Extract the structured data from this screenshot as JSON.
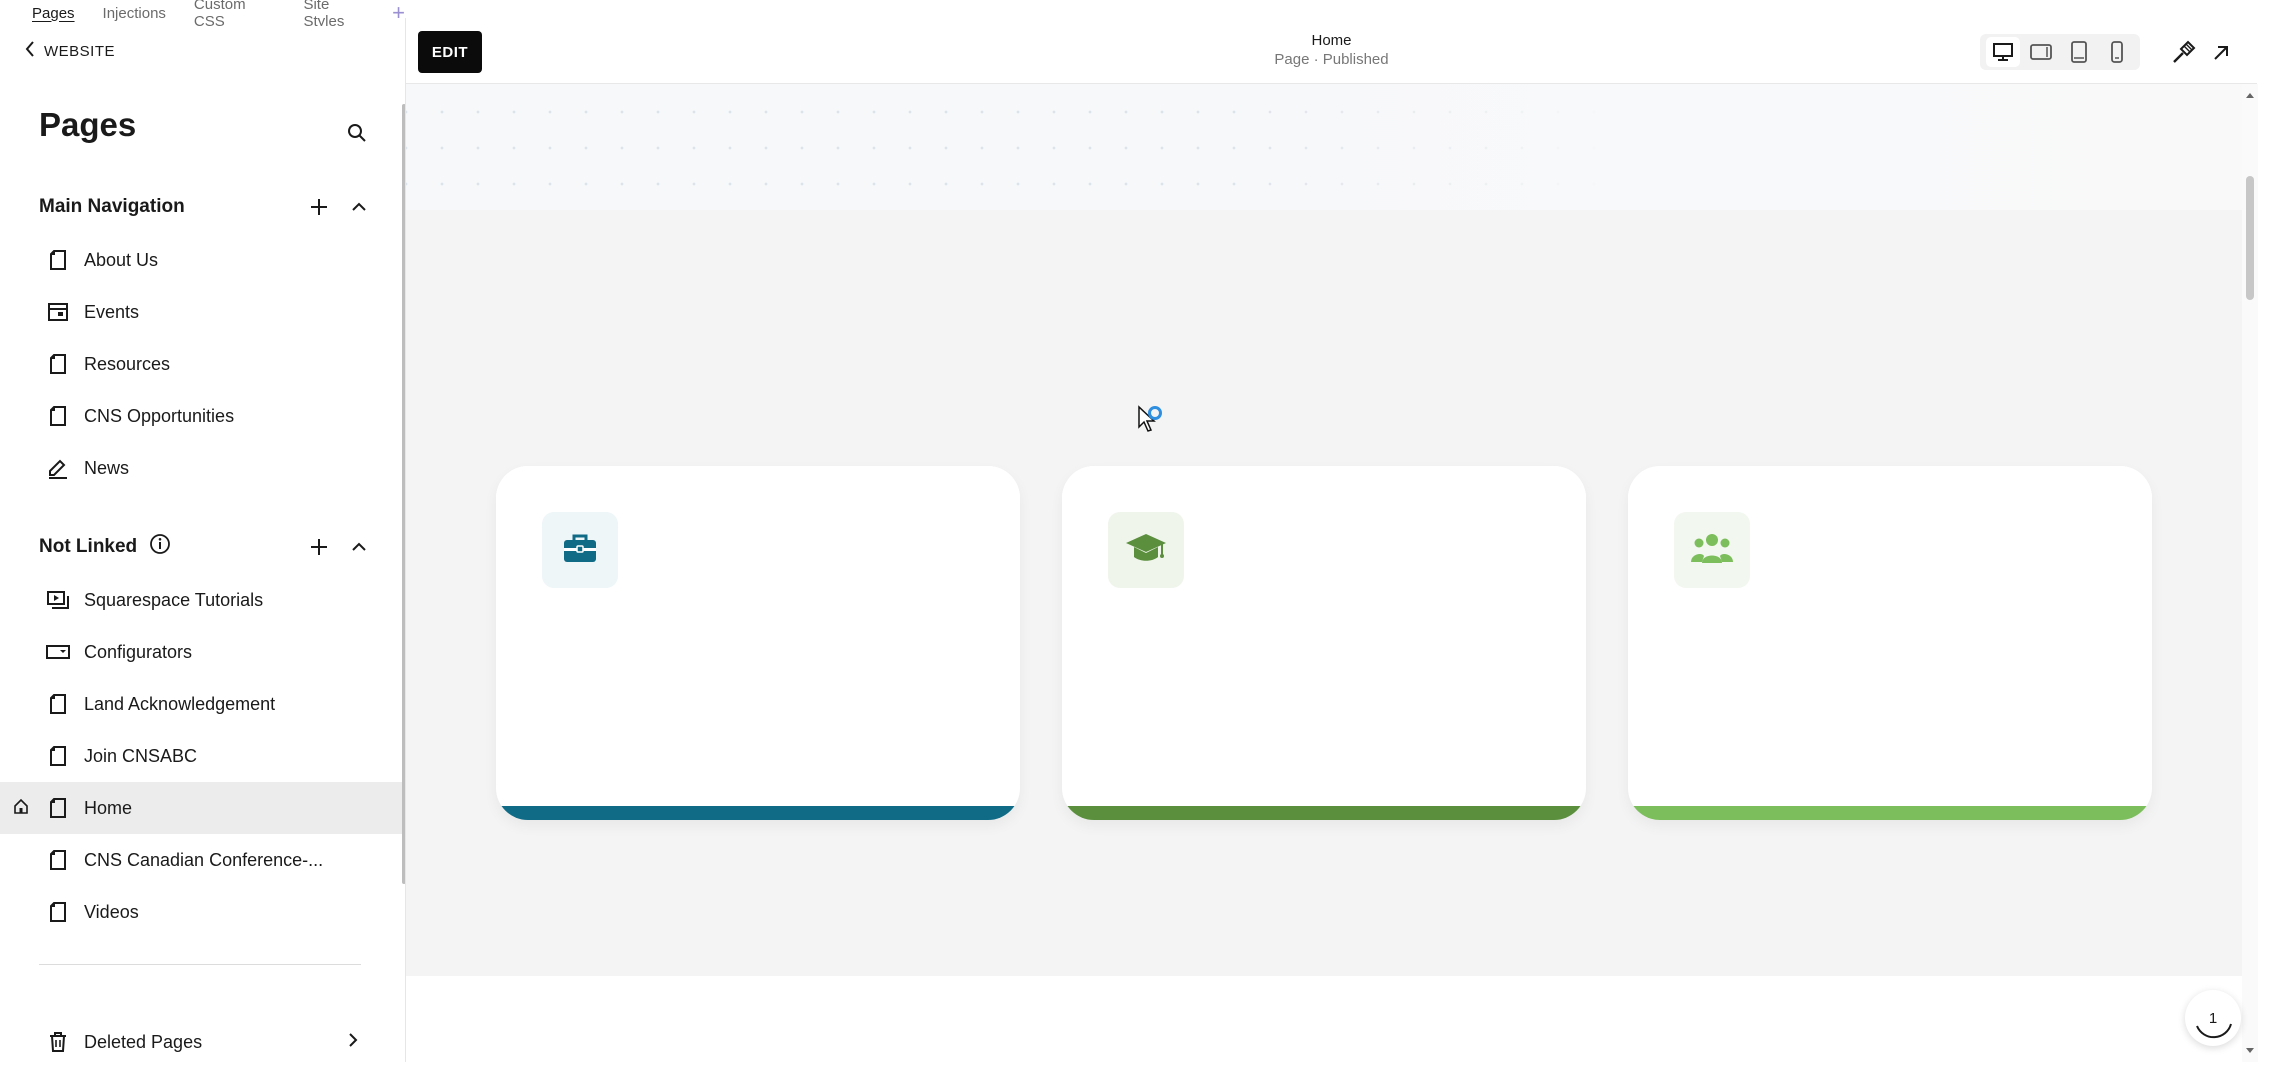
{
  "top_tabs": [
    "Pages",
    "Injections",
    "Custom CSS",
    "Site Styles"
  ],
  "back_label": "WEBSITE",
  "pages_title": "Pages",
  "main_nav": {
    "title": "Main Navigation",
    "items": [
      {
        "label": "About Us",
        "icon": "page-icon"
      },
      {
        "label": "Events",
        "icon": "calendar-page-icon"
      },
      {
        "label": "Resources",
        "icon": "page-icon"
      },
      {
        "label": "CNS Opportunities",
        "icon": "page-icon"
      },
      {
        "label": "News",
        "icon": "blog-icon"
      }
    ]
  },
  "not_linked": {
    "title": "Not Linked",
    "items": [
      {
        "label": "Squarespace Tutorials",
        "icon": "video-page-icon"
      },
      {
        "label": "Configurators",
        "icon": "dropdown-page-icon"
      },
      {
        "label": "Land Acknowledgement",
        "icon": "page-icon"
      },
      {
        "label": "Join CNSABC",
        "icon": "page-icon"
      },
      {
        "label": "Home",
        "icon": "page-icon",
        "is_homepage": true,
        "selected": true
      },
      {
        "label": "CNS Canadian Conference-...",
        "icon": "page-icon"
      },
      {
        "label": "Videos",
        "icon": "page-icon"
      }
    ]
  },
  "deleted_pages": "Deleted Pages",
  "preview": {
    "edit_label": "EDIT",
    "page_title": "Home",
    "page_status": "Page · Published",
    "devices": [
      "desktop",
      "tablet-landscape",
      "tablet-portrait",
      "mobile"
    ],
    "active_device": "desktop",
    "cards": [
      {
        "icon": "briefcase-icon",
        "accent": "#0f6b86",
        "icon_bg": "#eef6f8"
      },
      {
        "icon": "graduation-cap-icon",
        "accent": "#5b8f3e",
        "icon_bg": "#f0f5ec"
      },
      {
        "icon": "users-icon",
        "accent": "#7cbd5c",
        "icon_bg": "#f2f7ef"
      }
    ]
  },
  "badge_count": "1"
}
